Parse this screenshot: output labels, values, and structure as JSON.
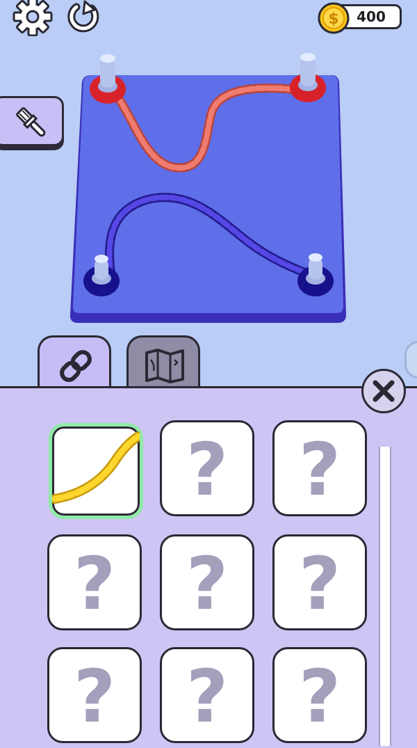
{
  "header": {
    "settings_icon": "gear-icon",
    "restart_icon": "restart-icon",
    "coins": "400",
    "coin_icon": "dollar-coin-icon"
  },
  "board": {
    "pegs": [
      "red",
      "red",
      "blue",
      "blue"
    ],
    "chains": [
      "red-chain",
      "blue-chain"
    ]
  },
  "tabs": [
    {
      "name": "chains",
      "icon": "chain-link-icon",
      "active": true
    },
    {
      "name": "maps",
      "icon": "map-icon",
      "active": false
    }
  ],
  "panel": {
    "close_icon": "close-icon",
    "items": [
      {
        "label": "",
        "kind": "gold-chain",
        "selected": true
      },
      {
        "label": "?",
        "kind": "locked"
      },
      {
        "label": "?",
        "kind": "locked"
      },
      {
        "label": "?",
        "kind": "locked"
      },
      {
        "label": "?",
        "kind": "locked"
      },
      {
        "label": "?",
        "kind": "locked"
      },
      {
        "label": "?",
        "kind": "locked"
      },
      {
        "label": "?",
        "kind": "locked"
      },
      {
        "label": "?",
        "kind": "locked"
      }
    ]
  },
  "colors": {
    "background": "#b9cdf6",
    "board": "#5f6ee9",
    "red_chain": "#ec7468",
    "blue_chain": "#4a3fd4",
    "panel": "#cec5f4",
    "selected_outline": "#8fe9a6"
  }
}
